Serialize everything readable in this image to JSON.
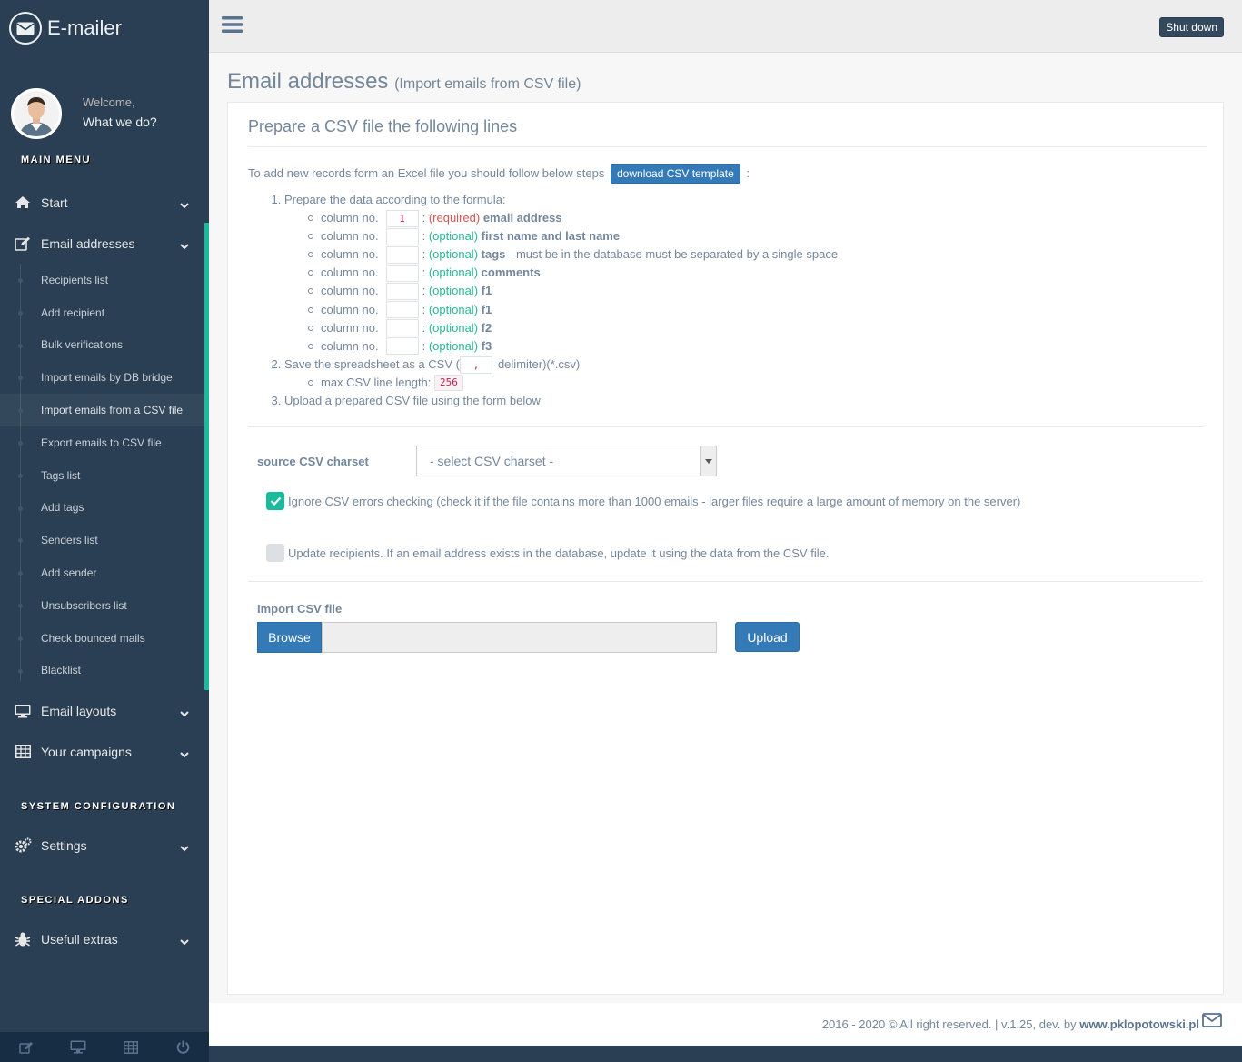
{
  "brand": {
    "title": "E-mailer"
  },
  "profile": {
    "welcome": "Welcome,",
    "subtitle": "What we do?"
  },
  "sidebar": {
    "section_main": "MAIN MENU",
    "section_config": "SYSTEM CONFIGURATION",
    "section_addons": "SPECIAL ADDONS",
    "start": "Start",
    "email_addresses": "Email addresses",
    "sub": [
      "Recipients list",
      "Add recipient",
      "Bulk verifications",
      "Import emails by DB bridge",
      "Import emails from a CSV file",
      "Export emails to CSV file",
      "Tags list",
      "Add tags",
      "Senders list",
      "Add sender",
      "Unsubscribers list",
      "Check bounced mails",
      "Blacklist"
    ],
    "email_layouts": "Email layouts",
    "campaigns": "Your campaigns",
    "settings": "Settings",
    "extras": "Usefull extras"
  },
  "topnav": {
    "shutdown": "Shut down"
  },
  "page": {
    "title": "Email addresses",
    "subtitle": "(Import emails from CSV file)",
    "panel_title": "Prepare a CSV file the following lines",
    "intro": "To add new records form an Excel file you should follow below steps",
    "download_btn": "download CSV template",
    "intro_end": ":",
    "step1": "Prepare the data according to the formula:",
    "col_prefix": "column no.",
    "columns": [
      {
        "no": "1",
        "kind": "(required)",
        "field": "email address",
        "extra": ""
      },
      {
        "no": "",
        "kind": "(optional)",
        "field": "first name and last name",
        "extra": ""
      },
      {
        "no": "",
        "kind": "(optional)",
        "field": "tags",
        "extra": " - must be in the database must be separated by a single space"
      },
      {
        "no": "",
        "kind": "(optional)",
        "field": "comments",
        "extra": ""
      },
      {
        "no": "",
        "kind": "(optional)",
        "field": "f1",
        "extra": ""
      },
      {
        "no": "",
        "kind": "(optional)",
        "field": "f1",
        "extra": ""
      },
      {
        "no": "",
        "kind": "(optional)",
        "field": "f2",
        "extra": ""
      },
      {
        "no": "",
        "kind": "(optional)",
        "field": "f3",
        "extra": ""
      }
    ],
    "step2_a": "Save the spreadsheet as a CSV (",
    "delimiter": ",",
    "step2_b": "delimiter)(*.csv)",
    "max_line_label": "max CSV line length:",
    "max_line_value": "256",
    "step3": "Upload a prepared CSV file using the form below",
    "charset_label": "source CSV charset",
    "charset_select": "- select CSV charset -",
    "ignore_label": "Ignore CSV errors checking (check it if the file contains more than 1000 emails - larger files require a large amount of memory on the server)",
    "update_label": "Update recipients. If an email address exists in the database, update it using the data from the CSV file.",
    "import_label": "Import CSV file",
    "browse_btn": "Browse",
    "upload_btn": "Upload"
  },
  "footer": {
    "text": "2016 - 2020 © All right reserved. | v.1.25, dev. by",
    "link": "www.pklopotowski.pl"
  },
  "colors": {
    "sidebar": "#2A3F54",
    "accent": "#1ABB9C",
    "primary": "#337AB7",
    "text": "#73879C"
  }
}
